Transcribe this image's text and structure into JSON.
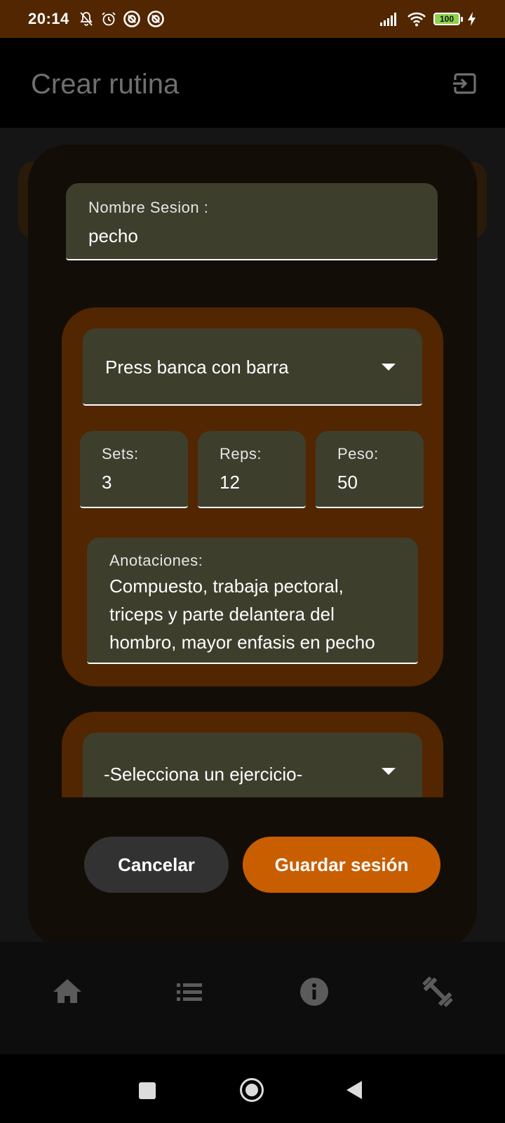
{
  "status_bar": {
    "time": "20:14",
    "battery": "100",
    "icons": [
      "mute-bell-icon",
      "alarm-icon",
      "focus-mode-icon",
      "focus-mode-icon",
      "signal-icon",
      "wifi-icon",
      "battery-icon",
      "charging-icon"
    ]
  },
  "app_bar": {
    "title": "Crear rutina",
    "action_icon": "exit-icon"
  },
  "dialog": {
    "session_name": {
      "label": "Nombre Sesion :",
      "value": "pecho"
    },
    "exercise_1": {
      "exercise": "Press banca con barra",
      "sets": {
        "label": "Sets:",
        "value": "3"
      },
      "reps": {
        "label": "Reps:",
        "value": "12"
      },
      "weight": {
        "label": "Peso:",
        "value": "50"
      },
      "notes": {
        "label": "Anotaciones:",
        "line1": "Compuesto, trabaja pectoral,",
        "line2": "triceps y parte delantera del",
        "line3": "hombro, mayor enfasis en pecho"
      }
    },
    "exercise_2": {
      "exercise": "-Selecciona un ejercicio-"
    },
    "cancel_label": "Cancelar",
    "save_label": "Guardar sesión"
  },
  "bottom_nav": [
    "home-icon",
    "list-icon",
    "info-icon",
    "dumbbell-icon"
  ],
  "colors": {
    "status_bar": "#522600",
    "card": "#522600",
    "field": "#3e3e2d",
    "save_button": "#c85e00",
    "cancel_button": "#323232"
  }
}
